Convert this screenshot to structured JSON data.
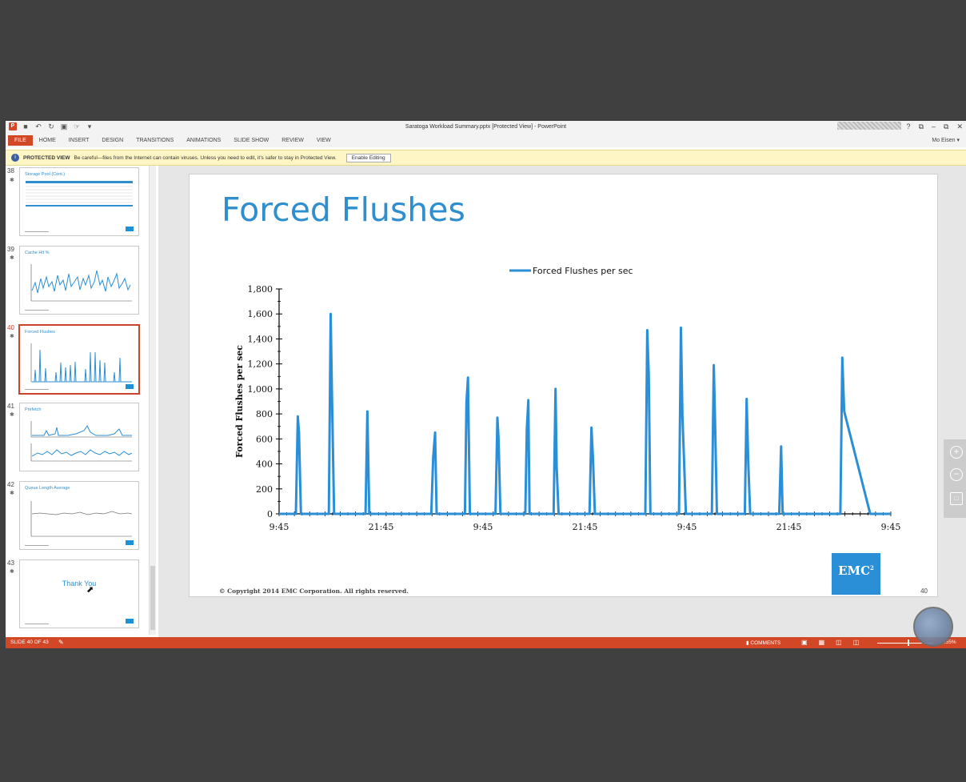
{
  "window": {
    "title": "Saratoga Workload Summary.pptx [Protected View] - PowerPoint",
    "user": "Mo Eisen ▾",
    "controls": [
      "?",
      "⧉",
      "–",
      "⧉",
      "✕"
    ]
  },
  "ribbon": {
    "tabs": [
      "FILE",
      "HOME",
      "INSERT",
      "DESIGN",
      "TRANSITIONS",
      "ANIMATIONS",
      "SLIDE SHOW",
      "REVIEW",
      "VIEW"
    ]
  },
  "protected_view": {
    "title": "PROTECTED VIEW",
    "message": "Be careful—files from the Internet can contain viruses. Unless you need to edit, it’s safer to stay in Protected View.",
    "button": "Enable Editing"
  },
  "thumbnails": [
    {
      "num": "38",
      "title": "Storage Pool (Cont.)",
      "kind": "table"
    },
    {
      "num": "39",
      "title": "Cache Hit %",
      "kind": "noisy"
    },
    {
      "num": "40",
      "title": "Forced Flushes",
      "kind": "spikes",
      "selected": true
    },
    {
      "num": "41",
      "title": "Prefetch",
      "kind": "double"
    },
    {
      "num": "42",
      "title": "Queue Length Average",
      "kind": "flat"
    },
    {
      "num": "43",
      "title": "",
      "kind": "thankyou",
      "text": "Thank You"
    }
  ],
  "slide": {
    "title": "Forced Flushes",
    "copyright": "© Copyright 2014 EMC Corporation. All rights reserved.",
    "number": "40",
    "logo": "EMC",
    "logo_sup": "2"
  },
  "chart_data": {
    "type": "line",
    "ylabel": "Forced Flushes per sec",
    "xlabel": "",
    "ylim": [
      0,
      1800
    ],
    "yticks": [
      0,
      200,
      400,
      600,
      800,
      1000,
      1200,
      1400,
      1600,
      1800
    ],
    "ytick_labels": [
      "0",
      "200",
      "400",
      "600",
      "800",
      "1,000",
      "1,200",
      "1,400",
      "1,600",
      "1,800"
    ],
    "xtick_labels": [
      "9:45",
      "21:45",
      "9:45",
      "21:45",
      "9:45",
      "21:45",
      "9:45"
    ],
    "legend": "top-center",
    "grid": false,
    "color": "#2a8fd6",
    "series": [
      {
        "name": "Forced Flushes per sec",
        "x": [
          0,
          2.2,
          2.45,
          2.6,
          2.85,
          3.1,
          6.5,
          6.75,
          6.9,
          7.2,
          7.4,
          11.3,
          11.55,
          11.8,
          19.9,
          20.15,
          20.4,
          20.6,
          20.85,
          24.3,
          24.5,
          24.7,
          24.95,
          28.3,
          28.55,
          28.7,
          28.95,
          32.2,
          32.4,
          32.6,
          32.75,
          33.0,
          35.9,
          36.15,
          36.3,
          36.55,
          40.6,
          40.85,
          41.05,
          41.3,
          47.9,
          48.15,
          48.35,
          48.55,
          48.75,
          48.95,
          52.3,
          52.55,
          52.75,
          52.95,
          53.2,
          56.6,
          56.85,
          57.05,
          57.25,
          57.45,
          60.9,
          61.15,
          61.35,
          61.6,
          65.4,
          65.65,
          65.85,
          66.1,
          73.4,
          73.65,
          73.9,
          77.3,
          77.55,
          77.75,
          77.95,
          78.2,
          80
        ],
        "y": [
          0,
          0,
          780,
          650,
          0,
          0,
          0,
          1600,
          1000,
          0,
          0,
          0,
          820,
          0,
          0,
          450,
          650,
          0,
          0,
          0,
          890,
          1090,
          0,
          0,
          770,
          610,
          0,
          0,
          680,
          910,
          0,
          0,
          0,
          1000,
          380,
          0,
          0,
          690,
          450,
          0,
          0,
          1470,
          1110,
          0,
          0,
          0,
          0,
          1490,
          780,
          450,
          0,
          0,
          1190,
          650,
          0,
          0,
          0,
          920,
          410,
          0,
          0,
          540,
          0,
          0,
          0,
          1250,
          820,
          0,
          0,
          0,
          0,
          0,
          0
        ]
      }
    ]
  },
  "status": {
    "slide": "SLIDE 40 OF 43",
    "comments": "COMMENTS",
    "zoom": "155%"
  }
}
